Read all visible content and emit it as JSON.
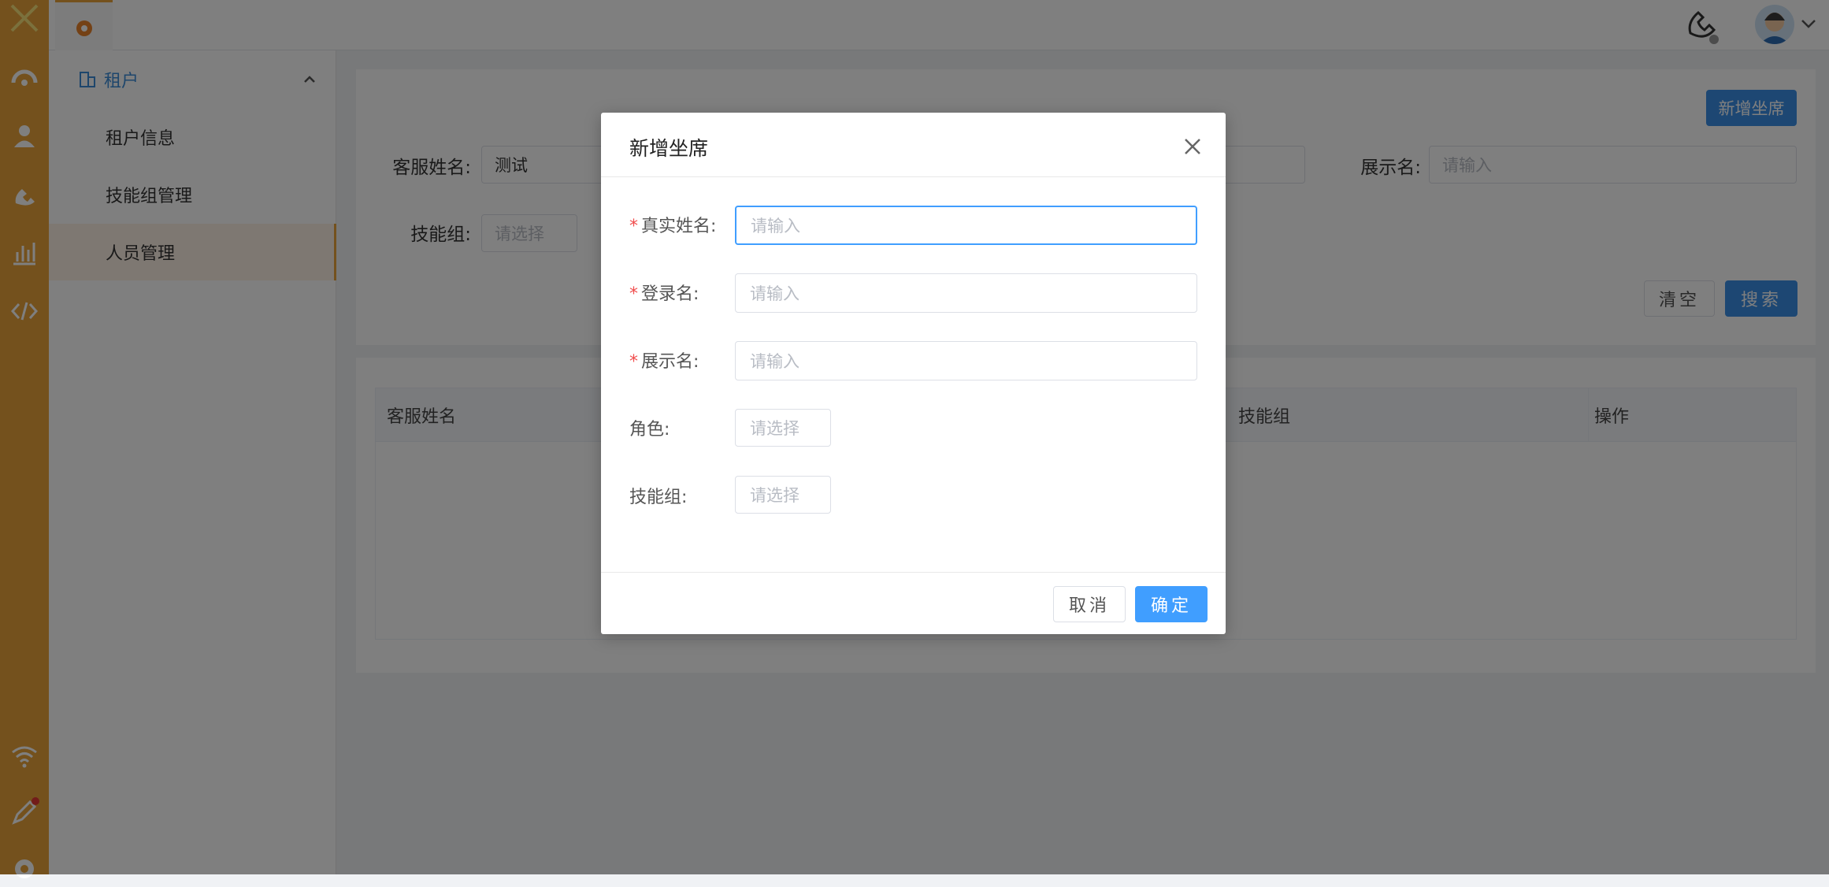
{
  "sidebar": {
    "group_label": "租户",
    "items": [
      {
        "label": "租户信息"
      },
      {
        "label": "技能组管理"
      },
      {
        "label": "人员管理"
      }
    ]
  },
  "search": {
    "agent_name_label": "客服姓名:",
    "agent_name_value": "测试",
    "display_name_label": "展示名:",
    "display_name_placeholder": "请输入",
    "skill_group_label": "技能组:",
    "skill_group_placeholder": "请选择",
    "add_button": "新增坐席",
    "clear_button": "清空",
    "search_button": "搜索"
  },
  "table": {
    "columns": [
      "客服姓名",
      "技能组",
      "操作"
    ]
  },
  "dialog": {
    "title": "新增坐席",
    "fields": [
      {
        "label": "真实姓名:",
        "placeholder": "请输入",
        "required": true
      },
      {
        "label": "登录名:",
        "placeholder": "请输入",
        "required": true
      },
      {
        "label": "展示名:",
        "placeholder": "请输入",
        "required": true
      },
      {
        "label": "角色:",
        "placeholder": "请选择",
        "required": false
      },
      {
        "label": "技能组:",
        "placeholder": "请选择",
        "required": false
      }
    ],
    "required_mark": "*",
    "cancel_button": "取消",
    "confirm_button": "确定"
  },
  "colors": {
    "accent_orange": "#e8a33a",
    "primary_blue": "#3a8ee6",
    "required_red": "#f04d4d"
  },
  "icons": {
    "rail": [
      "logo-icon",
      "dashboard-icon",
      "user-icon",
      "phone-icon",
      "chart-icon",
      "code-icon",
      "wifi-icon",
      "pencil-icon",
      "gear-icon"
    ],
    "header": [
      "settings-icon",
      "phone-icon",
      "avatar",
      "chevron-down-icon"
    ]
  }
}
